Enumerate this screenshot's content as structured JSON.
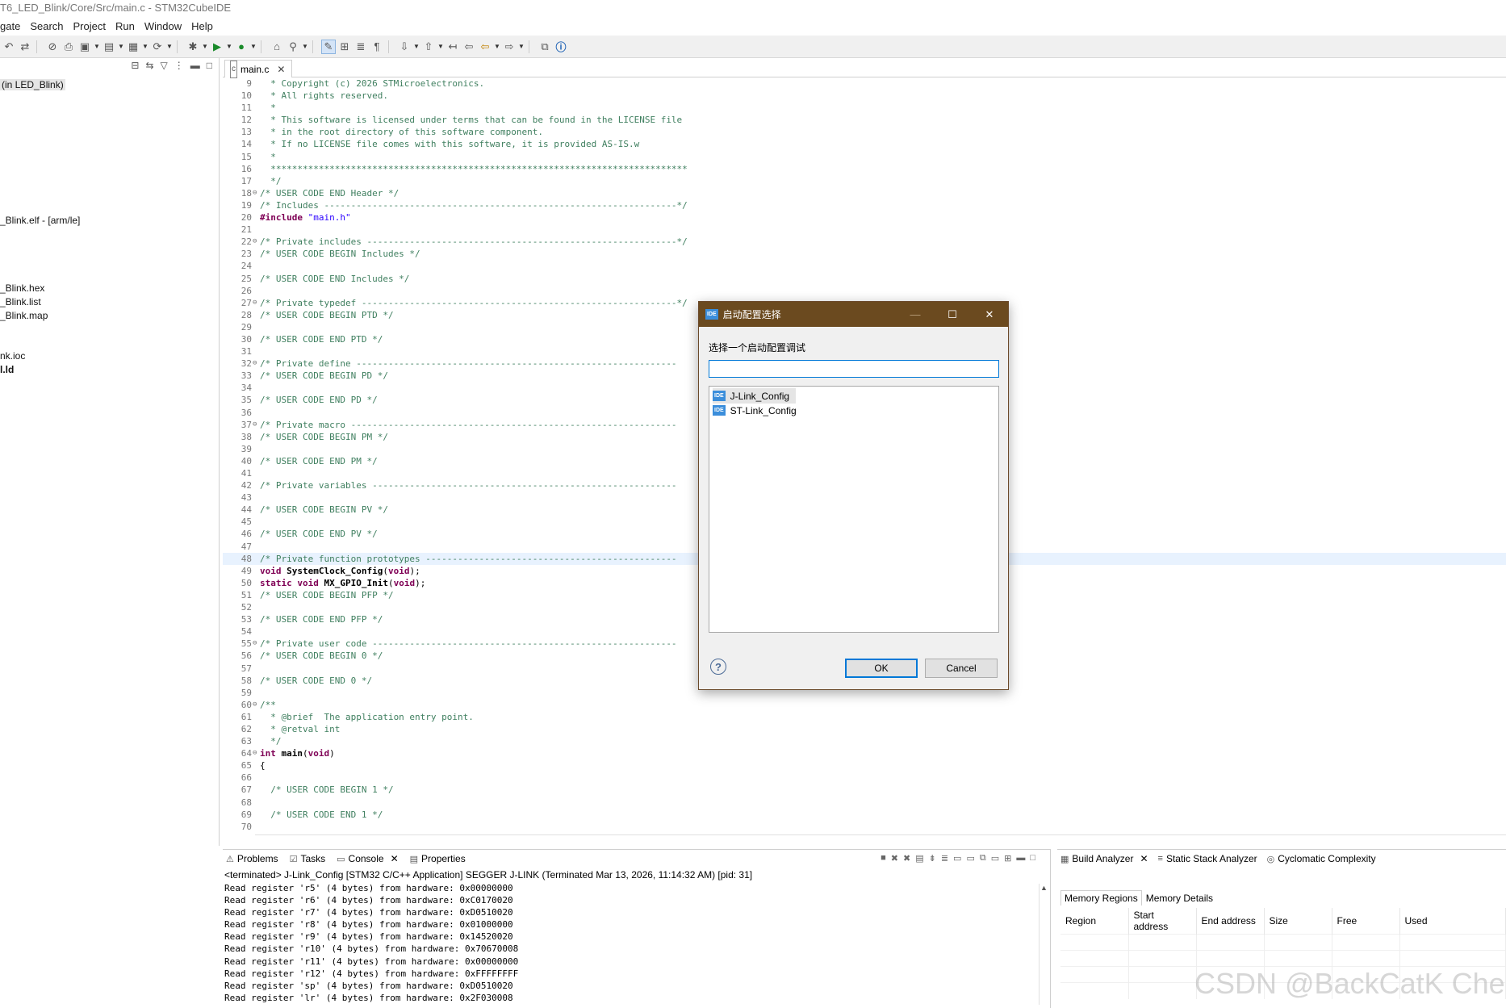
{
  "window": {
    "title": "T6_LED_Blink/Core/Src/main.c - STM32CubeIDE"
  },
  "menu": [
    "gate",
    "Search",
    "Project",
    "Run",
    "Window",
    "Help"
  ],
  "explorer": {
    "items": [
      {
        "label": "(in LED_Blink)"
      },
      {
        "label": "_Blink.elf - [arm/le]"
      },
      {
        "label": "_Blink.hex"
      },
      {
        "label": "_Blink.list"
      },
      {
        "label": "_Blink.map"
      },
      {
        "label": "nk.ioc"
      },
      {
        "label": "l.ld"
      }
    ]
  },
  "editor": {
    "tab": "main.c",
    "lines": [
      {
        "n": "9",
        "t": "  * Copyright (c) 2026 STMicroelectronics.",
        "c": "cm"
      },
      {
        "n": "10",
        "t": "  * All rights reserved.",
        "c": "cm"
      },
      {
        "n": "11",
        "t": "  *",
        "c": "cm"
      },
      {
        "n": "12",
        "t": "  * This software is licensed under terms that can be found in the LICENSE file",
        "c": "cm"
      },
      {
        "n": "13",
        "t": "  * in the root directory of this software component.",
        "c": "cm"
      },
      {
        "n": "14",
        "t": "  * If no LICENSE file comes with this software, it is provided AS-IS.w",
        "c": "cm"
      },
      {
        "n": "15",
        "t": "  *",
        "c": "cm"
      },
      {
        "n": "16",
        "t": "  ******************************************************************************",
        "c": "cm"
      },
      {
        "n": "17",
        "t": "  */",
        "c": "cm"
      },
      {
        "n": "18",
        "t": "/* USER CODE END Header */",
        "c": "cm",
        "fold": true
      },
      {
        "n": "19",
        "t": "/* Includes ------------------------------------------------------------------*/",
        "c": "cm"
      },
      {
        "n": "20",
        "t": "#include \"main.h\"",
        "c": "inc"
      },
      {
        "n": "21",
        "t": "",
        "c": ""
      },
      {
        "n": "22",
        "t": "/* Private includes ----------------------------------------------------------*/",
        "c": "cm",
        "fold": true
      },
      {
        "n": "23",
        "t": "/* USER CODE BEGIN Includes */",
        "c": "cm"
      },
      {
        "n": "24",
        "t": "",
        "c": ""
      },
      {
        "n": "25",
        "t": "/* USER CODE END Includes */",
        "c": "cm"
      },
      {
        "n": "26",
        "t": "",
        "c": ""
      },
      {
        "n": "27",
        "t": "/* Private typedef -----------------------------------------------------------*/",
        "c": "cm",
        "fold": true
      },
      {
        "n": "28",
        "t": "/* USER CODE BEGIN PTD */",
        "c": "cm"
      },
      {
        "n": "29",
        "t": "",
        "c": ""
      },
      {
        "n": "30",
        "t": "/* USER CODE END PTD */",
        "c": "cm"
      },
      {
        "n": "31",
        "t": "",
        "c": ""
      },
      {
        "n": "32",
        "t": "/* Private define ------------------------------------------------------------",
        "c": "cm",
        "fold": true
      },
      {
        "n": "33",
        "t": "/* USER CODE BEGIN PD */",
        "c": "cm"
      },
      {
        "n": "34",
        "t": "",
        "c": ""
      },
      {
        "n": "35",
        "t": "/* USER CODE END PD */",
        "c": "cm"
      },
      {
        "n": "36",
        "t": "",
        "c": ""
      },
      {
        "n": "37",
        "t": "/* Private macro -------------------------------------------------------------",
        "c": "cm",
        "fold": true
      },
      {
        "n": "38",
        "t": "/* USER CODE BEGIN PM */",
        "c": "cm"
      },
      {
        "n": "39",
        "t": "",
        "c": ""
      },
      {
        "n": "40",
        "t": "/* USER CODE END PM */",
        "c": "cm"
      },
      {
        "n": "41",
        "t": "",
        "c": ""
      },
      {
        "n": "42",
        "t": "/* Private variables ---------------------------------------------------------",
        "c": "cm"
      },
      {
        "n": "43",
        "t": "",
        "c": ""
      },
      {
        "n": "44",
        "t": "/* USER CODE BEGIN PV */",
        "c": "cm"
      },
      {
        "n": "45",
        "t": "",
        "c": ""
      },
      {
        "n": "46",
        "t": "/* USER CODE END PV */",
        "c": "cm"
      },
      {
        "n": "47",
        "t": "",
        "c": ""
      },
      {
        "n": "48",
        "t": "/* Private function prototypes -----------------------------------------------",
        "c": "cm",
        "hl": true
      },
      {
        "n": "49",
        "t": "void SystemClock_Config(void);",
        "c": "code"
      },
      {
        "n": "50",
        "t": "static void MX_GPIO_Init(void);",
        "c": "code"
      },
      {
        "n": "51",
        "t": "/* USER CODE BEGIN PFP */",
        "c": "cm"
      },
      {
        "n": "52",
        "t": "",
        "c": ""
      },
      {
        "n": "53",
        "t": "/* USER CODE END PFP */",
        "c": "cm"
      },
      {
        "n": "54",
        "t": "",
        "c": ""
      },
      {
        "n": "55",
        "t": "/* Private user code ---------------------------------------------------------",
        "c": "cm",
        "fold": true
      },
      {
        "n": "56",
        "t": "/* USER CODE BEGIN 0 */",
        "c": "cm"
      },
      {
        "n": "57",
        "t": "",
        "c": ""
      },
      {
        "n": "58",
        "t": "/* USER CODE END 0 */",
        "c": "cm"
      },
      {
        "n": "59",
        "t": "",
        "c": ""
      },
      {
        "n": "60",
        "t": "/**",
        "c": "cm",
        "fold": true
      },
      {
        "n": "61",
        "t": "  * @brief  The application entry point.",
        "c": "cm"
      },
      {
        "n": "62",
        "t": "  * @retval int",
        "c": "cm"
      },
      {
        "n": "63",
        "t": "  */",
        "c": "cm"
      },
      {
        "n": "64",
        "t": "int main(void)",
        "c": "code",
        "fold": true
      },
      {
        "n": "65",
        "t": "{",
        "c": ""
      },
      {
        "n": "66",
        "t": "",
        "c": ""
      },
      {
        "n": "67",
        "t": "  /* USER CODE BEGIN 1 */",
        "c": "cm"
      },
      {
        "n": "68",
        "t": "",
        "c": ""
      },
      {
        "n": "69",
        "t": "  /* USER CODE END 1 */",
        "c": "cm"
      },
      {
        "n": "70",
        "t": "",
        "c": ""
      }
    ]
  },
  "console": {
    "tabs": [
      "Problems",
      "Tasks",
      "Console",
      "Properties"
    ],
    "terminated": "<terminated> J-Link_Config [STM32 C/C++ Application] SEGGER J-LINK (Terminated Mar 13, 2026, 11:14:32 AM) [pid: 31]",
    "lines": [
      "Read register 'r5' (4 bytes) from hardware: 0x00000000",
      "Read register 'r6' (4 bytes) from hardware: 0xC0170020",
      "Read register 'r7' (4 bytes) from hardware: 0xD0510020",
      "Read register 'r8' (4 bytes) from hardware: 0x01000000",
      "Read register 'r9' (4 bytes) from hardware: 0x14520020",
      "Read register 'r10' (4 bytes) from hardware: 0x70670008",
      "Read register 'r11' (4 bytes) from hardware: 0x00000000",
      "Read register 'r12' (4 bytes) from hardware: 0xFFFFFFFF",
      "Read register 'sp' (4 bytes) from hardware: 0xD0510020",
      "Read register 'lr' (4 bytes) from hardware: 0x2F030008"
    ]
  },
  "analyzer": {
    "tabs": [
      "Build Analyzer",
      "Static Stack Analyzer",
      "Cyclomatic Complexity"
    ],
    "subtabs": [
      "Memory Regions",
      "Memory Details"
    ],
    "columns": [
      "Region",
      "Start address",
      "End address",
      "Size",
      "Free",
      "Used"
    ]
  },
  "dialog": {
    "title": "启动配置选择",
    "prompt": "选择一个启动配置调试",
    "search_value": "",
    "items": [
      "J-Link_Config",
      "ST-Link_Config"
    ],
    "ok": "OK",
    "cancel": "Cancel",
    "badge": "IDE"
  },
  "watermark": "CSDN @BackCatK Chen"
}
